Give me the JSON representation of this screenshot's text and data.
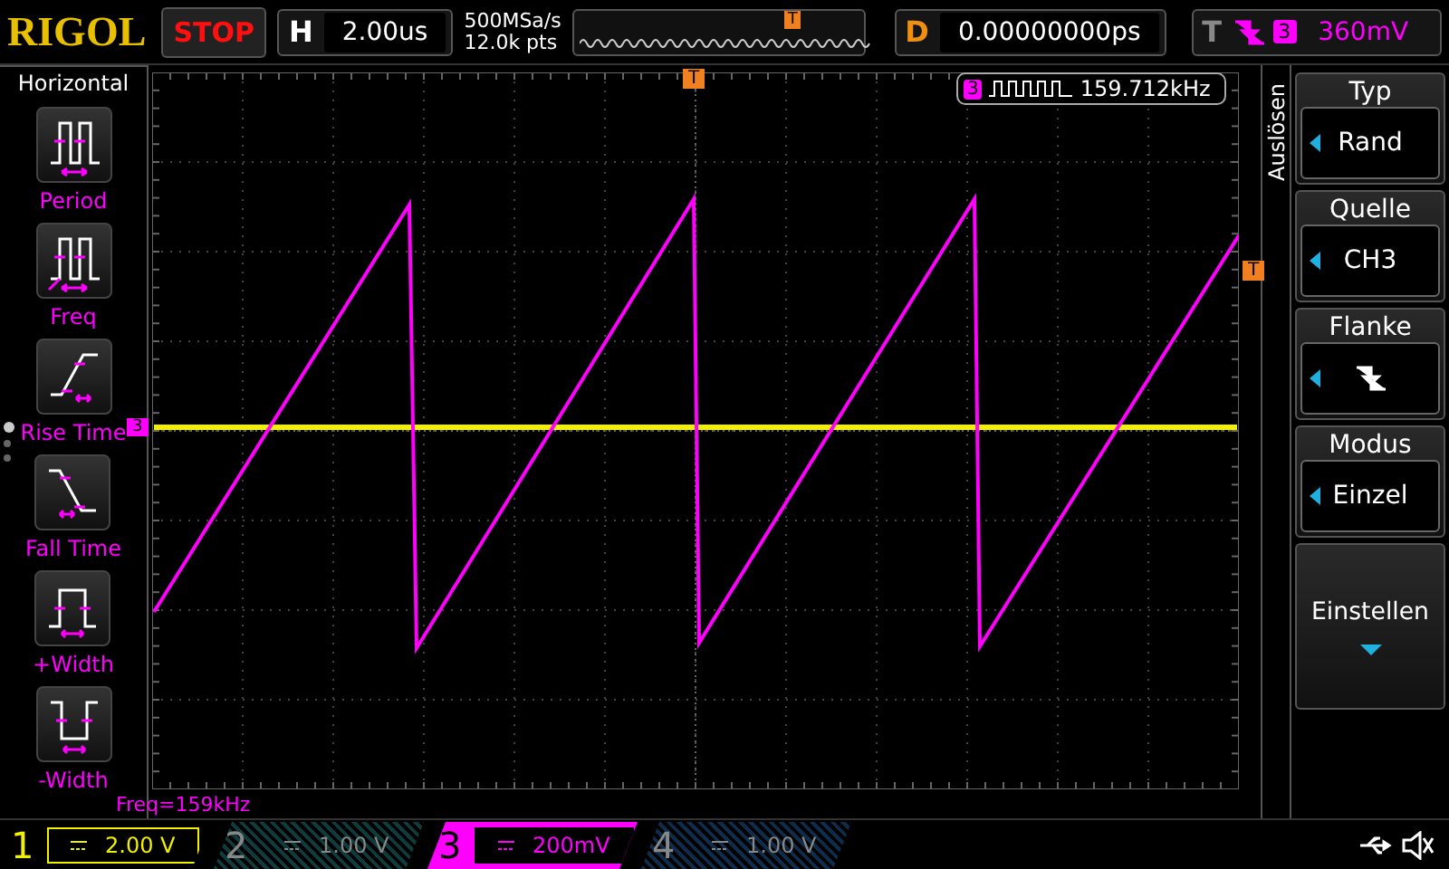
{
  "top_bar": {
    "logo": "RIGOL",
    "run_state": "STOP",
    "timebase": {
      "label": "H",
      "value": "2.00us"
    },
    "sample_rate": "500MSa/s",
    "memory_depth": "12.0k pts",
    "overview_marker": "T",
    "delay": {
      "label": "D",
      "value": "0.00000000ps"
    },
    "trigger": {
      "label": "T",
      "kind": "falling-edge",
      "source": "3",
      "level": "360mV"
    }
  },
  "measure_panel": {
    "title": "Horizontal",
    "items": [
      {
        "kind": "period",
        "label": "Period"
      },
      {
        "kind": "freq",
        "label": "Freq"
      },
      {
        "kind": "rise",
        "label": "Rise Time"
      },
      {
        "kind": "fall",
        "label": "Fall Time"
      },
      {
        "kind": "pwidth",
        "label": "+Width"
      },
      {
        "kind": "nwidth",
        "label": "-Width"
      }
    ],
    "pages": [
      {
        "selected": true
      },
      {
        "selected": false
      },
      {
        "selected": false
      }
    ]
  },
  "display": {
    "trigger_marker_top": "T",
    "trigger_marker_right": "T",
    "channel_marker": "3",
    "counter": {
      "channel": "3",
      "value": "159.712kHz"
    },
    "measurement": "Freq=159kHz"
  },
  "menu": {
    "tab": "Auslösen",
    "items": [
      {
        "kind": "option",
        "title": "Typ",
        "value": "Rand"
      },
      {
        "kind": "option",
        "title": "Quelle",
        "value": "CH3"
      },
      {
        "kind": "falling-edge",
        "title": "Flanke"
      },
      {
        "kind": "option",
        "title": "Modus",
        "value": "Einzel"
      },
      {
        "kind": "action",
        "title": "Einstellen"
      }
    ]
  },
  "channels": [
    {
      "number": "1",
      "scale": "2.00 V",
      "on": true,
      "selected": false,
      "color": "#f0f000"
    },
    {
      "number": "2",
      "scale": "1.00 V",
      "on": false,
      "selected": false,
      "color": "#0e3c3c"
    },
    {
      "number": "3",
      "scale": "200mV",
      "on": true,
      "selected": true,
      "color": "#ff00ff"
    },
    {
      "number": "4",
      "scale": "1.00 V",
      "on": false,
      "selected": false,
      "color": "#0e2c4c"
    }
  ]
}
